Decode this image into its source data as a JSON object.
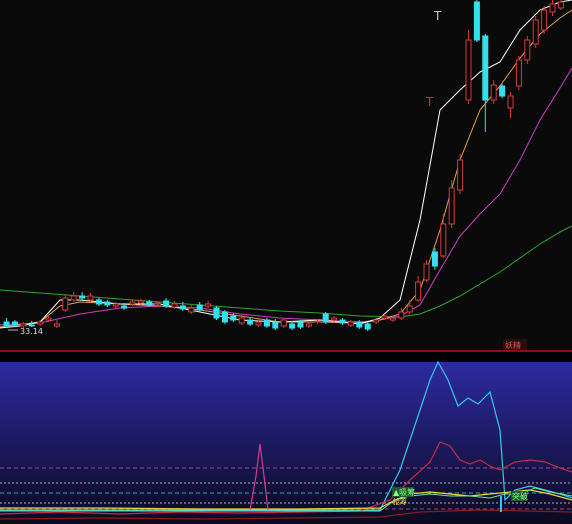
{
  "price_panel": {
    "low_marker": "33.14",
    "t_marker_top": "T",
    "t_marker_mid": "T",
    "tag": "妖精"
  },
  "indicator_panel": {
    "buy_signal": "▲吸筹",
    "buy_signal_2": "抢筹",
    "breakout_label": "突破"
  },
  "colors": {
    "up": "#d23a3a",
    "down": "#33e0ee",
    "ma5": "#ffffff",
    "ma10": "#e0a04a",
    "ma20": "#d23ac8",
    "ma60": "#2fa52f",
    "panel_bg_top": "#2d2aa0",
    "panel_bg_bottom": "#0b0a1f",
    "grid_dashed": "#d24a8a"
  },
  "chart_data": {
    "type": "candlestick",
    "series": [
      {
        "name": "MA5",
        "type": "line"
      },
      {
        "name": "MA10",
        "type": "line"
      },
      {
        "name": "MA20",
        "type": "line"
      },
      {
        "name": "MA60",
        "type": "line"
      }
    ],
    "candles": [
      [
        322,
        326,
        318,
        328,
        0
      ],
      [
        325,
        322,
        320,
        327,
        0
      ],
      [
        324,
        326,
        322,
        328,
        1
      ],
      [
        326,
        325,
        321,
        327,
        0
      ],
      [
        322,
        324,
        320,
        326,
        1
      ],
      [
        318,
        320,
        316,
        322,
        1
      ],
      [
        324,
        326,
        320,
        328,
        1
      ],
      [
        310,
        298,
        294,
        312,
        1
      ],
      [
        300,
        296,
        292,
        302,
        1
      ],
      [
        296,
        298,
        292,
        300,
        0
      ],
      [
        296,
        300,
        293,
        302,
        1
      ],
      [
        300,
        304,
        298,
        306,
        0
      ],
      [
        302,
        305,
        300,
        307,
        0
      ],
      [
        304,
        306,
        302,
        308,
        1
      ],
      [
        306,
        308,
        303,
        310,
        0
      ],
      [
        302,
        304,
        300,
        306,
        1
      ],
      [
        303,
        301,
        299,
        305,
        1
      ],
      [
        305,
        302,
        300,
        307,
        0
      ],
      [
        304,
        303,
        301,
        306,
        1
      ],
      [
        301,
        306,
        298,
        308,
        0
      ],
      [
        304,
        307,
        301,
        309,
        1
      ],
      [
        306,
        309,
        302,
        311,
        0
      ],
      [
        308,
        312,
        305,
        314,
        1
      ],
      [
        305,
        310,
        302,
        312,
        0
      ],
      [
        304,
        306,
        301,
        308,
        1
      ],
      [
        308,
        318,
        306,
        320,
        0
      ],
      [
        312,
        322,
        310,
        324,
        0
      ],
      [
        316,
        320,
        313,
        322,
        0
      ],
      [
        318,
        323,
        315,
        325,
        1
      ],
      [
        320,
        324,
        317,
        326,
        0
      ],
      [
        322,
        325,
        319,
        327,
        1
      ],
      [
        320,
        326,
        318,
        328,
        0
      ],
      [
        322,
        328,
        319,
        330,
        0
      ],
      [
        320,
        326,
        318,
        328,
        1
      ],
      [
        324,
        328,
        321,
        330,
        0
      ],
      [
        322,
        327,
        320,
        329,
        0
      ],
      [
        326,
        324,
        322,
        328,
        1
      ],
      [
        322,
        321,
        319,
        324,
        1
      ],
      [
        314,
        322,
        312,
        324,
        0
      ],
      [
        318,
        320,
        316,
        322,
        1
      ],
      [
        320,
        323,
        318,
        325,
        0
      ],
      [
        322,
        325,
        320,
        327,
        1
      ],
      [
        322,
        327,
        320,
        329,
        0
      ],
      [
        324,
        329,
        322,
        331,
        0
      ],
      [
        320,
        322,
        318,
        324,
        1
      ],
      [
        318,
        316,
        314,
        320,
        1
      ],
      [
        320,
        318,
        316,
        322,
        1
      ],
      [
        318,
        312,
        308,
        320,
        1
      ],
      [
        312,
        306,
        300,
        314,
        1
      ],
      [
        300,
        282,
        276,
        302,
        1
      ],
      [
        280,
        264,
        260,
        282,
        1
      ],
      [
        266,
        252,
        248,
        270,
        0
      ],
      [
        256,
        224,
        214,
        258,
        1
      ],
      [
        224,
        188,
        180,
        228,
        1
      ],
      [
        190,
        160,
        154,
        194,
        1
      ],
      [
        100,
        40,
        30,
        104,
        1
      ],
      [
        40,
        2,
        0,
        42,
        0
      ],
      [
        36,
        100,
        34,
        132,
        0
      ],
      [
        100,
        85,
        80,
        104,
        1
      ],
      [
        86,
        96,
        84,
        98,
        0
      ],
      [
        96,
        108,
        92,
        118,
        1
      ],
      [
        86,
        60,
        56,
        90,
        1
      ],
      [
        60,
        40,
        36,
        64,
        1
      ],
      [
        44,
        20,
        16,
        48,
        1
      ],
      [
        30,
        10,
        6,
        34,
        1
      ],
      [
        12,
        4,
        0,
        16,
        1
      ],
      [
        8,
        2,
        0,
        10,
        1
      ]
    ],
    "ylabel": "",
    "xlabel": ""
  }
}
